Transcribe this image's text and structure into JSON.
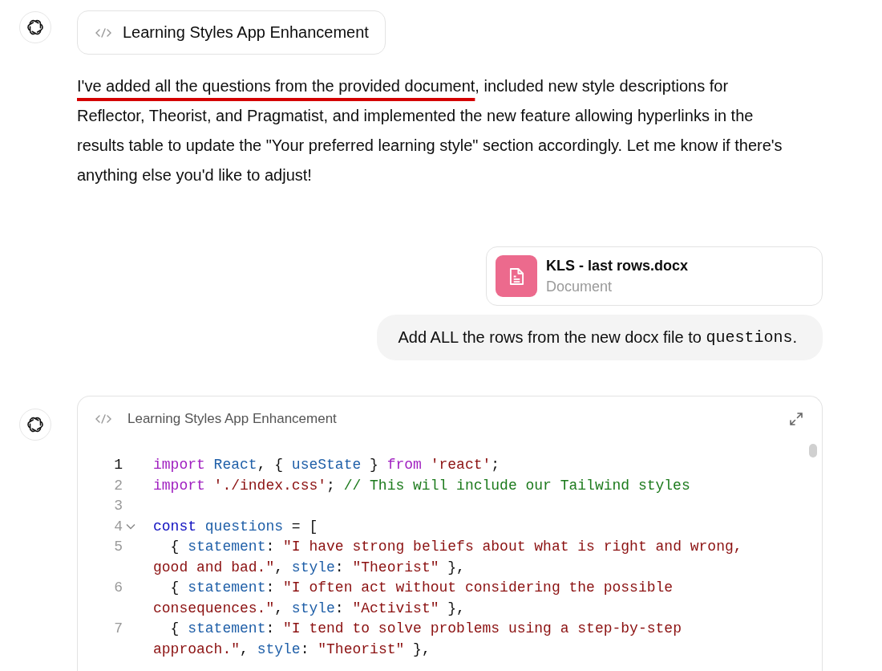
{
  "assistant_turn_1": {
    "artifact_chip": {
      "title": "Learning Styles App Enhancement"
    },
    "message": {
      "highlighted": "I've added all the questions from the provided document",
      "rest": ", included new style descriptions for Reflector, Theorist, and Pragmatist, and implemented the new feature allowing hyperlinks in the results table to update the \"Your preferred learning style\" section accordingly. Let me know if there's anything else you'd like to adjust!"
    }
  },
  "user_turn": {
    "attachment": {
      "name": "KLS - last rows.docx",
      "type": "Document"
    },
    "message": [
      {
        "kind": "text",
        "text": "Add ALL the rows from the new docx file to "
      },
      {
        "kind": "code",
        "text": "questions"
      },
      {
        "kind": "text",
        "text": "."
      }
    ]
  },
  "assistant_turn_2": {
    "code_panel": {
      "title": "Learning Styles App Enhancement",
      "lines": [
        {
          "number": "1",
          "current": true,
          "rows": [
            {
              "tokens": [
                {
                  "kind": "keyword",
                  "text": "import"
                },
                {
                  "kind": "ident",
                  "text": " React"
                },
                {
                  "kind": "plain",
                  "text": ", { "
                },
                {
                  "kind": "ident",
                  "text": "useState"
                },
                {
                  "kind": "plain",
                  "text": " } "
                },
                {
                  "kind": "keyword",
                  "text": "from"
                },
                {
                  "kind": "string",
                  "text": " 'react'"
                },
                {
                  "kind": "plain",
                  "text": ";"
                }
              ]
            }
          ]
        },
        {
          "number": "2",
          "current": false,
          "rows": [
            {
              "tokens": [
                {
                  "kind": "keyword",
                  "text": "import"
                },
                {
                  "kind": "string",
                  "text": " './index.css'"
                },
                {
                  "kind": "plain",
                  "text": "; "
                },
                {
                  "kind": "comment",
                  "text": "// This will include our Tailwind styles"
                }
              ]
            }
          ]
        },
        {
          "number": "3",
          "current": false
        },
        {
          "number": "4",
          "current": false,
          "foldable": true,
          "rows": [
            {
              "tokens": [
                {
                  "kind": "decl",
                  "text": "const"
                },
                {
                  "kind": "ident",
                  "text": " questions"
                },
                {
                  "kind": "plain",
                  "text": " = ["
                }
              ]
            }
          ]
        },
        {
          "number": "5",
          "current": false,
          "rows": [
            {
              "tokens": [
                {
                  "kind": "plain",
                  "text": "  { "
                },
                {
                  "kind": "ident",
                  "text": "statement"
                },
                {
                  "kind": "plain",
                  "text": ": "
                },
                {
                  "kind": "string",
                  "text": "\"I have strong beliefs about what is right and wrong,"
                }
              ]
            },
            {
              "tokens": [
                {
                  "kind": "string",
                  "text": "good and bad.\""
                },
                {
                  "kind": "plain",
                  "text": ", "
                },
                {
                  "kind": "ident",
                  "text": "style"
                },
                {
                  "kind": "plain",
                  "text": ": "
                },
                {
                  "kind": "string",
                  "text": "\"Theorist\""
                },
                {
                  "kind": "plain",
                  "text": " },"
                }
              ]
            }
          ]
        },
        {
          "number": "6",
          "current": false,
          "rows": [
            {
              "tokens": [
                {
                  "kind": "plain",
                  "text": "  { "
                },
                {
                  "kind": "ident",
                  "text": "statement"
                },
                {
                  "kind": "plain",
                  "text": ": "
                },
                {
                  "kind": "string",
                  "text": "\"I often act without considering the possible"
                }
              ]
            },
            {
              "tokens": [
                {
                  "kind": "string",
                  "text": "consequences.\""
                },
                {
                  "kind": "plain",
                  "text": ", "
                },
                {
                  "kind": "ident",
                  "text": "style"
                },
                {
                  "kind": "plain",
                  "text": ": "
                },
                {
                  "kind": "string",
                  "text": "\"Activist\""
                },
                {
                  "kind": "plain",
                  "text": " },"
                }
              ]
            }
          ]
        },
        {
          "number": "7",
          "current": false,
          "rows": [
            {
              "tokens": [
                {
                  "kind": "plain",
                  "text": "  { "
                },
                {
                  "kind": "ident",
                  "text": "statement"
                },
                {
                  "kind": "plain",
                  "text": ": "
                },
                {
                  "kind": "string",
                  "text": "\"I tend to solve problems using a step-by-step"
                }
              ]
            },
            {
              "tokens": [
                {
                  "kind": "string",
                  "text": "approach.\""
                },
                {
                  "kind": "plain",
                  "text": ", "
                },
                {
                  "kind": "ident",
                  "text": "style"
                },
                {
                  "kind": "plain",
                  "text": ": "
                },
                {
                  "kind": "string",
                  "text": "\"Theorist\""
                },
                {
                  "kind": "plain",
                  "text": " },"
                }
              ]
            }
          ]
        }
      ]
    }
  }
}
